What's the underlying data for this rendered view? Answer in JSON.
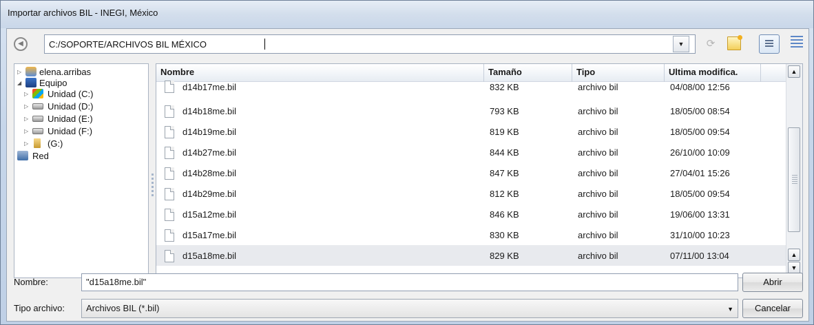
{
  "window": {
    "title": "Importar archivos BIL - INEGI, México"
  },
  "toolbar": {
    "path": "C:/SOPORTE/ARCHIVOS BIL MÉXICO",
    "icons": [
      "back-icon",
      "refresh-icon",
      "new-folder-icon",
      "list-view-icon",
      "details-view-icon"
    ]
  },
  "tree": {
    "items": [
      {
        "label": "elena.arribas",
        "icon": "user-folder-icon",
        "expander": "▷"
      },
      {
        "label": "Equipo",
        "icon": "computer-icon",
        "expander": "◢"
      },
      {
        "label": "Unidad (C:)",
        "icon": "system-drive-icon",
        "expander": "▷"
      },
      {
        "label": "Unidad (D:)",
        "icon": "drive-icon",
        "expander": "▷"
      },
      {
        "label": "Unidad (E:)",
        "icon": "drive-icon",
        "expander": "▷"
      },
      {
        "label": "Unidad (F:)",
        "icon": "drive-icon",
        "expander": "▷"
      },
      {
        "label": "(G:)",
        "icon": "usb-drive-icon",
        "expander": "▷"
      },
      {
        "label": "Red",
        "icon": "network-icon",
        "expander": ""
      }
    ]
  },
  "list": {
    "columns": [
      "Nombre",
      "Tamaño",
      "Tipo",
      "Ultima modifica."
    ],
    "rows": [
      {
        "name": "d14b17me.bil",
        "size": "832 KB",
        "type": "archivo bil",
        "modified": "04/08/00 12:56"
      },
      {
        "name": "d14b18me.bil",
        "size": "793 KB",
        "type": "archivo bil",
        "modified": "18/05/00 08:54"
      },
      {
        "name": "d14b19me.bil",
        "size": "819 KB",
        "type": "archivo bil",
        "modified": "18/05/00 09:54"
      },
      {
        "name": "d14b27me.bil",
        "size": "844 KB",
        "type": "archivo bil",
        "modified": "26/10/00 10:09"
      },
      {
        "name": "d14b28me.bil",
        "size": "847 KB",
        "type": "archivo bil",
        "modified": "27/04/01 15:26"
      },
      {
        "name": "d14b29me.bil",
        "size": "812 KB",
        "type": "archivo bil",
        "modified": "18/05/00 09:54"
      },
      {
        "name": "d15a12me.bil",
        "size": "846 KB",
        "type": "archivo bil",
        "modified": "19/06/00 13:31"
      },
      {
        "name": "d15a17me.bil",
        "size": "830 KB",
        "type": "archivo bil",
        "modified": "31/10/00 10:23"
      },
      {
        "name": "d15a18me.bil",
        "size": "829 KB",
        "type": "archivo bil",
        "modified": "07/11/00 13:04"
      }
    ],
    "selected_index": 8
  },
  "footer": {
    "name_label": "Nombre:",
    "name_value": "\"d15a18me.bil\"",
    "type_label": "Tipo archivo:",
    "type_value": "Archivos BIL (*.bil)",
    "open_label": "Abrir",
    "cancel_label": "Cancelar"
  }
}
